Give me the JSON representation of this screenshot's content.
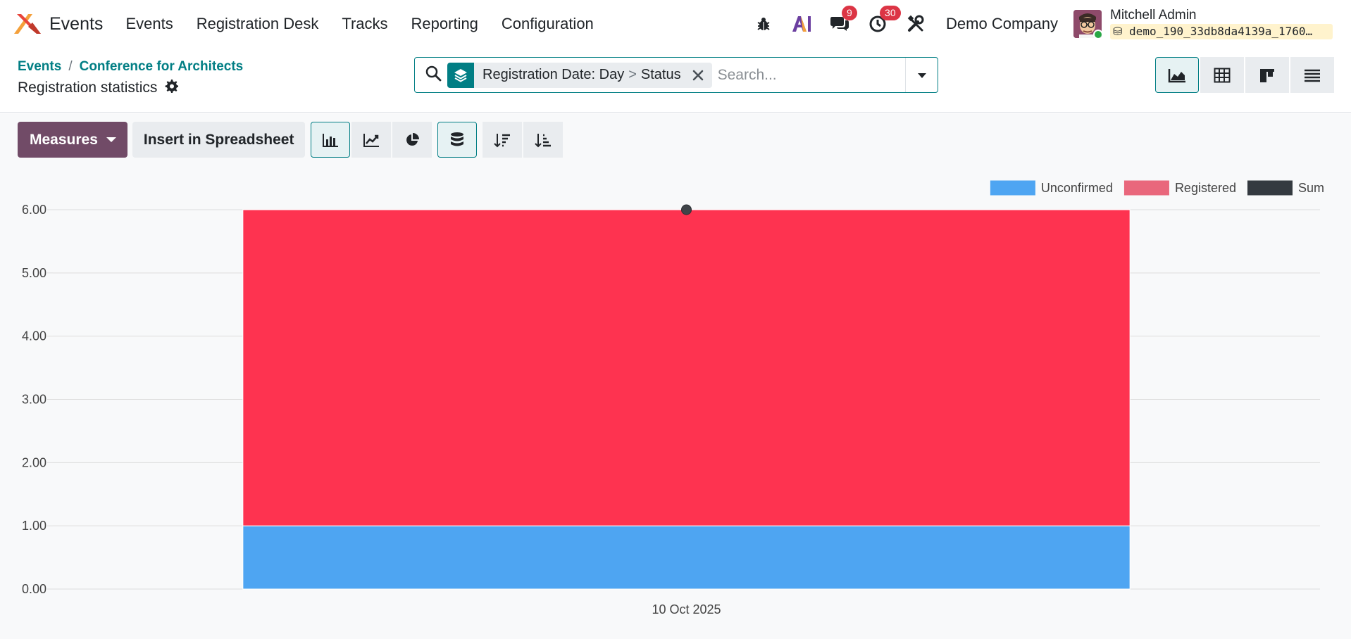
{
  "app": {
    "name": "Events"
  },
  "menu": [
    {
      "label": "Events"
    },
    {
      "label": "Registration Desk"
    },
    {
      "label": "Tracks"
    },
    {
      "label": "Reporting"
    },
    {
      "label": "Configuration"
    }
  ],
  "systray": {
    "messages_count": "9",
    "activities_count": "30",
    "company": "Demo Company",
    "user_name": "Mitchell Admin",
    "database": "demo_190_33db8da4139a_1760…"
  },
  "breadcrumb": {
    "root": "Events",
    "parent": "Conference for Architects",
    "separator": "/"
  },
  "page_title": "Registration statistics",
  "search": {
    "facet_field": "Registration Date: Day",
    "facet_sep": ">",
    "facet_value": "Status",
    "placeholder": "Search..."
  },
  "toolbar": {
    "measures_label": "Measures",
    "spreadsheet_label": "Insert in Spreadsheet"
  },
  "colors": {
    "brand": "#714b67",
    "accent": "#017e84",
    "unconfirmed": "#4ea5f2",
    "registered": "#fe3350",
    "sum": "#343a40"
  },
  "chart_data": {
    "type": "bar",
    "stacked": true,
    "categories": [
      "10 Oct 2025"
    ],
    "series": [
      {
        "name": "Unconfirmed",
        "values": [
          1
        ],
        "color": "#4ea5f2"
      },
      {
        "name": "Registered",
        "values": [
          5
        ],
        "color": "#fe3350"
      }
    ],
    "sum": {
      "name": "Sum",
      "values": [
        6
      ],
      "color": "#343a40"
    },
    "legend": [
      {
        "name": "Unconfirmed",
        "color": "#4ea5f2"
      },
      {
        "name": "Registered",
        "color": "#e9677c"
      },
      {
        "name": "Sum",
        "color": "#343a40"
      }
    ],
    "legend_position": "top-right",
    "ylim": [
      0,
      6
    ],
    "yticks": [
      "0.00",
      "1.00",
      "2.00",
      "3.00",
      "4.00",
      "5.00",
      "6.00"
    ],
    "grid": true
  }
}
